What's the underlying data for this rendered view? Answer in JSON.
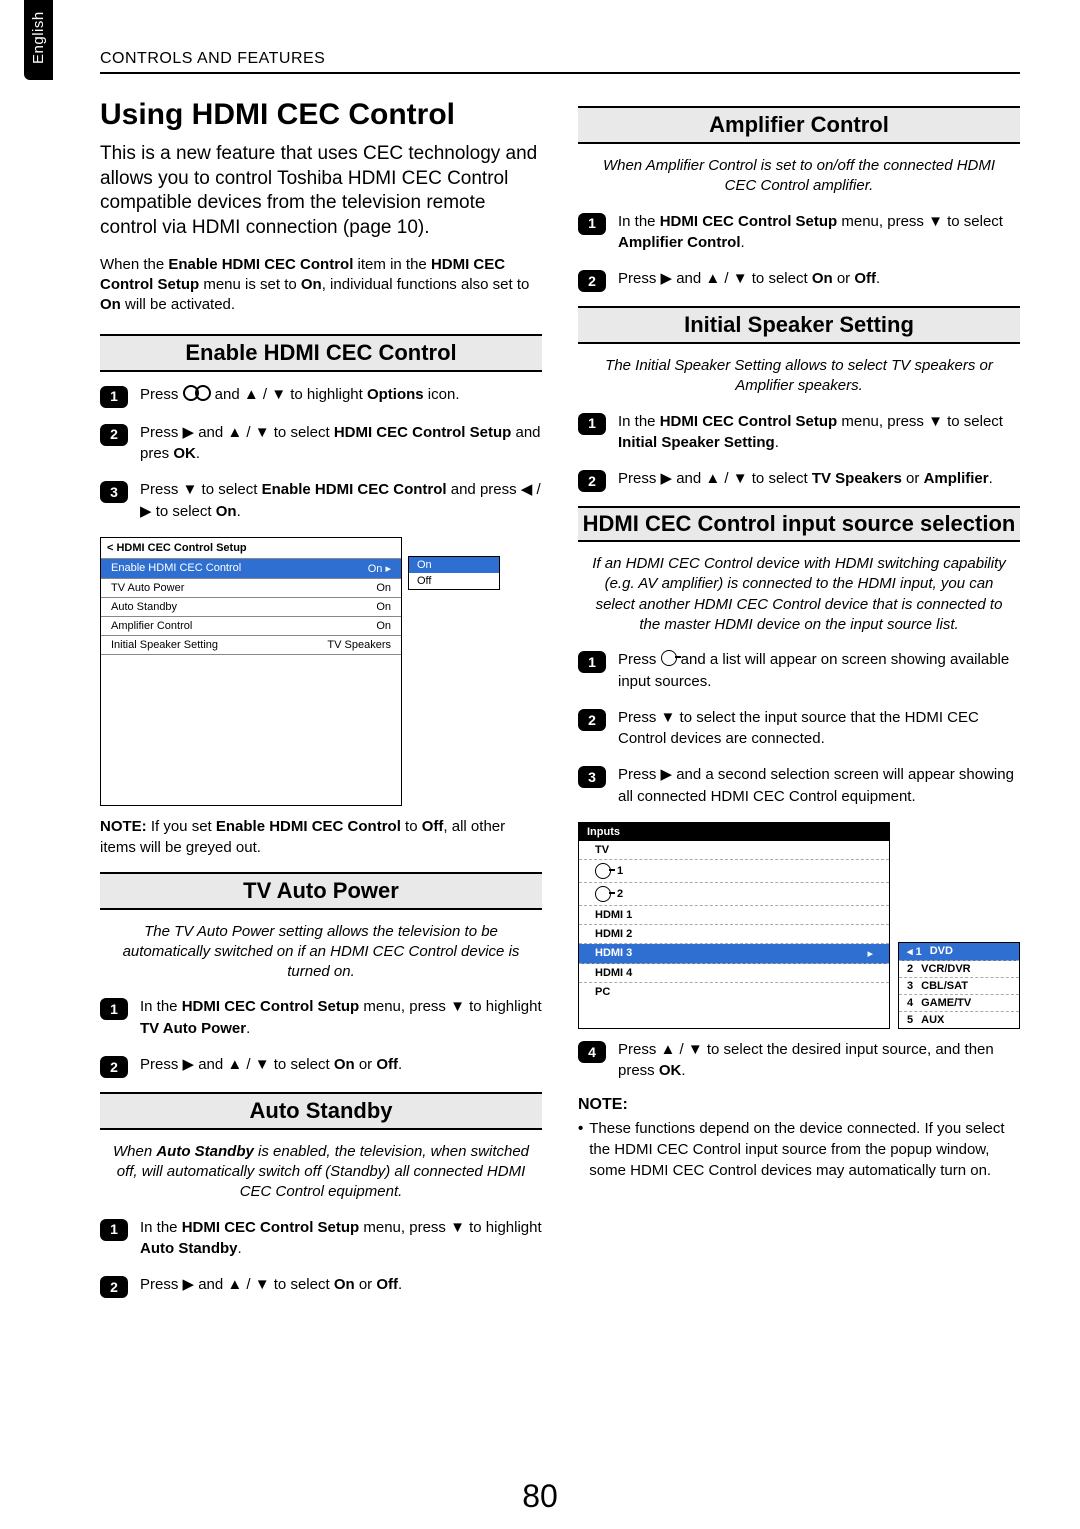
{
  "header": "CONTROLS AND FEATURES",
  "lang": "English",
  "page_number": "80",
  "left": {
    "title": "Using HDMI CEC Control",
    "intro": "This is a new feature that uses CEC technology and allows you to control Toshiba HDMI CEC Control compatible devices from the television remote control via HDMI connection (page 10).",
    "precond": [
      "When the ",
      "Enable HDMI CEC Control",
      " item in the ",
      "HDMI CEC Control Setup",
      " menu is set to ",
      "On",
      ", individual functions also set to ",
      "On",
      " will be activated."
    ],
    "sect_enable": "Enable HDMI CEC Control",
    "enable_steps": [
      [
        "Press ",
        " and ▲ / ▼ to highlight ",
        "Options",
        " icon."
      ],
      [
        "Press ▶ and ▲ / ▼ to select ",
        "HDMI CEC Control Setup",
        " and pres ",
        "OK",
        "."
      ],
      [
        "Press ▼ to select ",
        "Enable HDMI CEC Control",
        " and press ◀ / ▶ to select ",
        "On",
        "."
      ]
    ],
    "menu": {
      "title": "< HDMI CEC Control Setup",
      "rows": [
        {
          "label": "Enable HDMI CEC Control",
          "val": "On ▸",
          "sel": true
        },
        {
          "label": "TV Auto Power",
          "val": "On"
        },
        {
          "label": "Auto Standby",
          "val": "On"
        },
        {
          "label": "Amplifier Control",
          "val": "On"
        },
        {
          "label": "Initial Speaker Setting",
          "val": "TV Speakers"
        }
      ],
      "popup": [
        "On",
        "Off"
      ]
    },
    "enable_note": [
      "NOTE:",
      " If you set ",
      "Enable HDMI CEC Control",
      " to ",
      "Off",
      ", all other items will be greyed out."
    ],
    "sect_tvauto": "TV Auto Power",
    "tvauto_em": "The TV Auto Power setting allows the television to be automatically switched on if an HDMI CEC Control device is turned on.",
    "tvauto_steps": [
      [
        "In the ",
        "HDMI CEC Control Setup",
        " menu, press ▼ to highlight ",
        "TV Auto Power",
        "."
      ],
      [
        "Press ▶ and ▲ / ▼ to select ",
        "On",
        " or ",
        "Off",
        "."
      ]
    ],
    "sect_autostb": "Auto Standby",
    "autostb_em": [
      "When ",
      "Auto Standby",
      " is enabled, the television, when switched off, will automatically switch off (Standby) all connected HDMI CEC Control equipment."
    ],
    "autostb_steps": [
      [
        "In the ",
        "HDMI CEC Control Setup",
        " menu, press ▼ to highlight ",
        "Auto Standby",
        "."
      ],
      [
        "Press ▶ and ▲ / ▼ to select ",
        "On",
        " or ",
        "Off",
        "."
      ]
    ]
  },
  "right": {
    "sect_amp": "Amplifier Control",
    "amp_em": "When Amplifier Control is set to on/off the connected HDMI CEC Control amplifier.",
    "amp_steps": [
      [
        "In the ",
        "HDMI CEC Control Setup",
        " menu, press ▼ to select ",
        "Amplifier Control",
        "."
      ],
      [
        "Press ▶ and ▲ / ▼ to select ",
        "On",
        " or ",
        "Off",
        "."
      ]
    ],
    "sect_spk": "Initial Speaker Setting",
    "spk_em": "The Initial Speaker Setting allows to select TV speakers or Amplifier speakers.",
    "spk_steps": [
      [
        "In the ",
        "HDMI CEC Control Setup",
        " menu, press ▼ to select ",
        "Initial Speaker Setting",
        "."
      ],
      [
        "Press ▶ and ▲ / ▼ to select ",
        "TV Speakers",
        " or ",
        "Amplifier",
        "."
      ]
    ],
    "sect_src": "HDMI CEC Control input source selection",
    "src_em": "If an HDMI CEC Control device with HDMI switching capability (e.g. AV amplifier) is connected to the HDMI input, you can select another HDMI CEC Control device that is connected to the master HDMI device on the input source list.",
    "src_steps": [
      [
        "Press ",
        " and a list will appear on screen showing available input sources."
      ],
      [
        "Press ▼ to select the input source that the HDMI CEC Control devices are connected."
      ],
      [
        "Press ▶ and a second selection screen will appear showing all connected HDMI CEC Control equipment."
      ]
    ],
    "inputs": {
      "title": "Inputs",
      "rows": [
        {
          "label": "TV"
        },
        {
          "label": "1",
          "icon": true
        },
        {
          "label": "2",
          "icon": true
        },
        {
          "label": "HDMI 1"
        },
        {
          "label": "HDMI 2"
        },
        {
          "label": "HDMI 3",
          "sel": true,
          "arrow": "▸"
        },
        {
          "label": "HDMI 4"
        },
        {
          "label": "PC"
        }
      ]
    },
    "devices": [
      {
        "n": "◂ 1",
        "label": "DVD",
        "sel": true
      },
      {
        "n": "2",
        "label": "VCR/DVR"
      },
      {
        "n": "3",
        "label": "CBL/SAT"
      },
      {
        "n": "4",
        "label": "GAME/TV"
      },
      {
        "n": "5",
        "label": "AUX"
      }
    ],
    "src_step4": [
      "Press ▲ / ▼ to select the desired input source, and then press ",
      "OK",
      "."
    ],
    "note_label": "NOTE:",
    "note_bullet": "These functions depend on the device connected. If you select the HDMI CEC Control input source from the popup window, some HDMI CEC Control devices may automatically turn on."
  }
}
